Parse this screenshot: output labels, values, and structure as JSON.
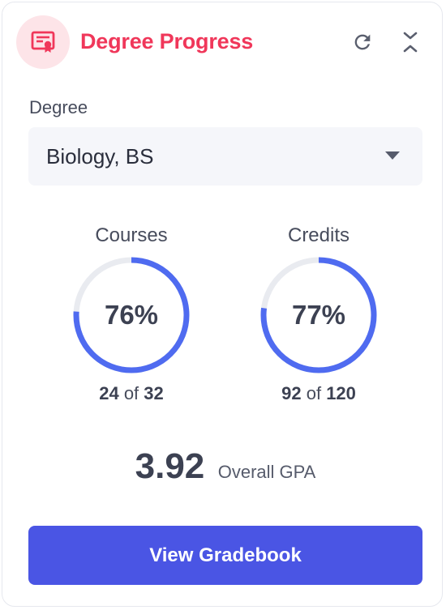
{
  "header": {
    "title": "Degree Progress",
    "icon": "certificate-icon",
    "refresh_icon": "refresh-icon",
    "collapse_icon": "collapse-icon"
  },
  "degree": {
    "label": "Degree",
    "selected": "Biology, BS"
  },
  "stats": {
    "courses": {
      "title": "Courses",
      "percent_label": "76%",
      "percent": 76,
      "completed": "24",
      "separator": "of",
      "total": "32"
    },
    "credits": {
      "title": "Credits",
      "percent_label": "77%",
      "percent": 77,
      "completed": "92",
      "separator": "of",
      "total": "120"
    }
  },
  "gpa": {
    "value": "3.92",
    "label": "Overall GPA"
  },
  "actions": {
    "gradebook_label": "View Gradebook"
  },
  "colors": {
    "accent": "#f0375a",
    "accent_bg": "#fde4e8",
    "progress": "#4f6bf0",
    "track": "#e9ebf0",
    "button": "#4a55e4"
  }
}
